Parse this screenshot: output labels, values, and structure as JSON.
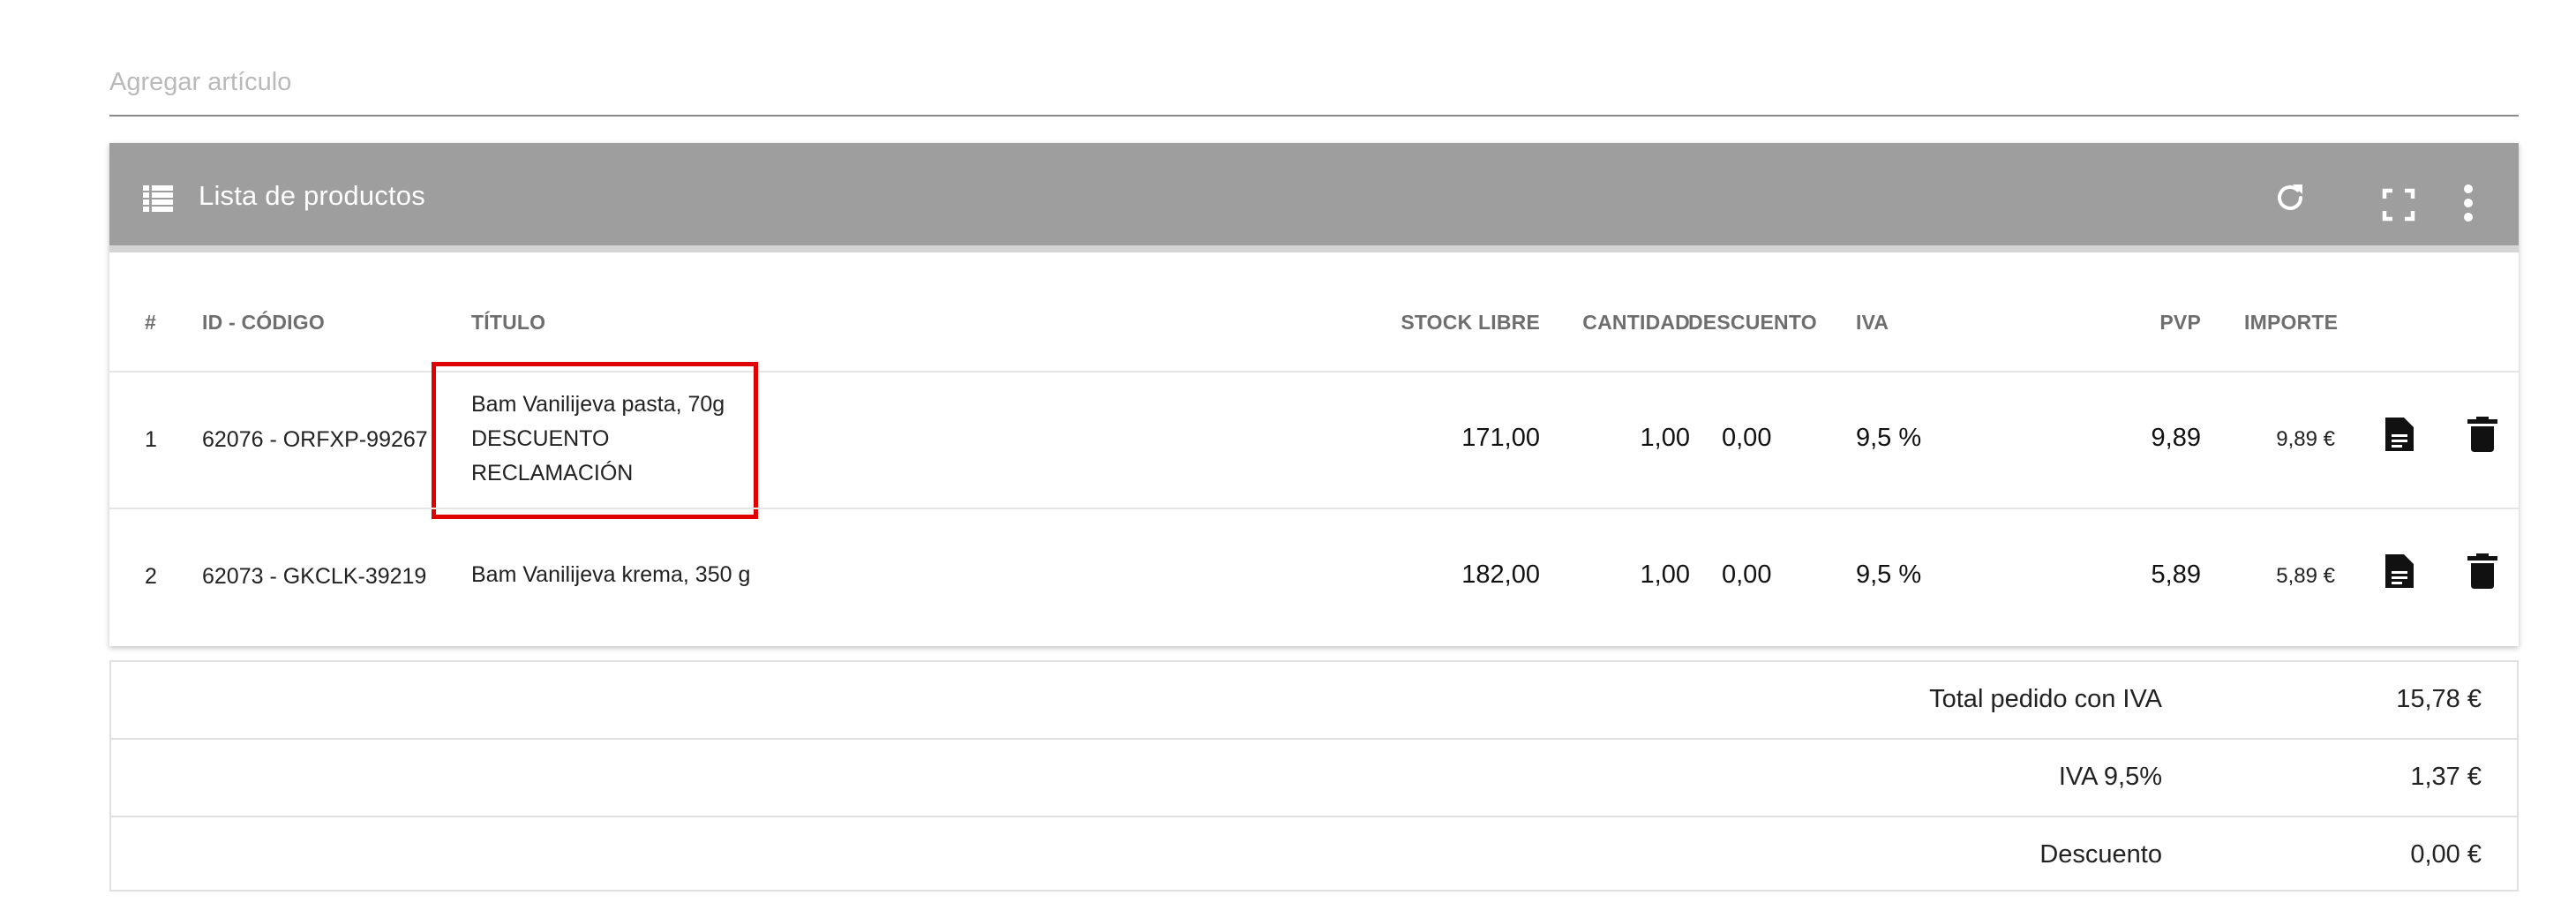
{
  "add_article": {
    "placeholder": "Agregar artículo"
  },
  "header": {
    "title": "Lista de productos",
    "color": "#9e9e9e",
    "icons": [
      "list-icon",
      "refresh-icon",
      "fullscreen-icon",
      "more-vert-icon"
    ]
  },
  "table": {
    "columns": {
      "num": "#",
      "id": "ID - CÓDIGO",
      "title": "TÍTULO",
      "stock": "STOCK LIBRE",
      "qty": "CANTIDAD",
      "discount": "DESCUENTO",
      "vat": "IVA",
      "price": "PVP",
      "amount": "IMPORTE"
    },
    "rows": [
      {
        "num": "1",
        "id": "62076 - ORFXP-99267",
        "title_lines": [
          "Bam Vanilijeva pasta, 70g",
          "DESCUENTO",
          "RECLAMACIÓN"
        ],
        "stock": "171,00",
        "qty": "1,00",
        "discount": "0,00",
        "vat": "9,5 %",
        "price": "9,89",
        "amount": "9,89 €"
      },
      {
        "num": "2",
        "id": "62073 - GKCLK-39219",
        "title_lines": [
          "Bam Vanilijeva krema, 350 g"
        ],
        "stock": "182,00",
        "qty": "1,00",
        "discount": "0,00",
        "vat": "9,5 %",
        "price": "5,89",
        "amount": "5,89 €"
      }
    ],
    "row_icons": [
      "document-icon",
      "trash-icon"
    ],
    "highlight_color": "#e00000"
  },
  "totals": [
    {
      "label": "Total pedido con IVA",
      "value": "15,78 €"
    },
    {
      "label": "IVA 9,5%",
      "value": "1,37 €"
    },
    {
      "label": "Descuento",
      "value": "0,00 €"
    }
  ]
}
